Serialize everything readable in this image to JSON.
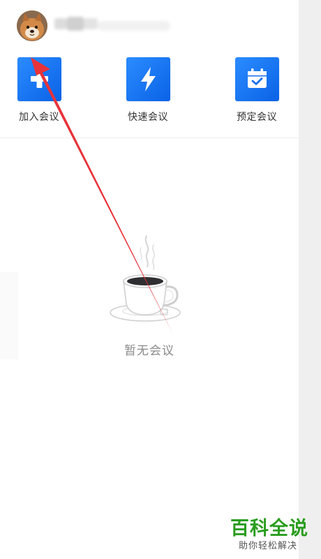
{
  "header": {
    "avatar_icon": "dog-avatar-icon",
    "username": ""
  },
  "actions": [
    {
      "label": "加入会议",
      "icon": "plus-icon"
    },
    {
      "label": "快速会议",
      "icon": "lightning-icon"
    },
    {
      "label": "预定会议",
      "icon": "calendar-check-icon"
    }
  ],
  "empty_state": {
    "icon": "coffee-cup-icon",
    "text": "暂无会议"
  },
  "annotation": {
    "arrow_color": "#e8333a"
  },
  "watermark": {
    "title": "百科全说",
    "subtitle": "助你轻松解决",
    "color": "#2a9d1e"
  },
  "colors": {
    "accent": "#1677ff",
    "background": "#ffffff",
    "side_strip": "#efefef"
  }
}
